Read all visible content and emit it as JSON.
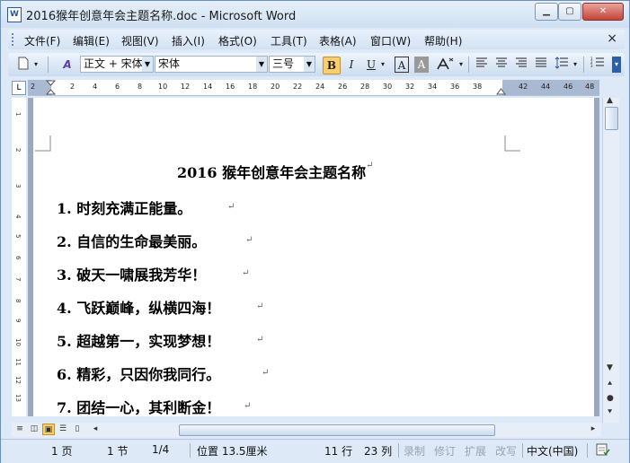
{
  "window": {
    "title": "2016猴年创意年会主题名称.doc - Microsoft Word",
    "app_icon": "W",
    "minimize": "▁",
    "maximize": "▢",
    "close": "✕"
  },
  "menu": {
    "items": [
      "文件(F)",
      "编辑(E)",
      "视图(V)",
      "插入(I)",
      "格式(O)",
      "工具(T)",
      "表格(A)",
      "窗口(W)",
      "帮助(H)"
    ],
    "close": "×"
  },
  "toolbar": {
    "style_value": "正文 + 宋体",
    "font_value": "宋体",
    "size_value": "三号",
    "bold": "B",
    "italic": "I",
    "underline": "U",
    "char_border": "A",
    "char_shading": "A"
  },
  "ruler": {
    "ticks": [
      "2",
      "2",
      "4",
      "6",
      "8",
      "10",
      "12",
      "14",
      "16",
      "18",
      "20",
      "22",
      "24",
      "26",
      "28",
      "30",
      "32",
      "34",
      "36",
      "38",
      "42",
      "44",
      "46",
      "48"
    ],
    "vticks": [
      "1",
      "2",
      "3",
      "4",
      "5",
      "6",
      "7",
      "8",
      "9",
      "10",
      "11",
      "12",
      "13",
      "14",
      "15",
      "16"
    ]
  },
  "document": {
    "title": "2016 猴年创意年会主题名称",
    "items": [
      "1. 时刻充满正能量。",
      "2. 自信的生命最美丽。",
      "3. 破天一啸展我芳华！",
      "4. 飞跃巅峰，纵横四海！",
      "5. 超越第一，实现梦想！",
      "6. 精彩，只因你我同行。",
      "7. 团结一心，其利断金！"
    ],
    "para_mark": "↵"
  },
  "statusbar": {
    "page": "1 页",
    "section": "1 节",
    "page_of": "1/4",
    "position": "位置 13.5厘米",
    "line": "11 行",
    "column": "23 列",
    "rec": "录制",
    "trk": "修订",
    "ext": "扩展",
    "ovr": "改写",
    "language": "中文(中国)"
  },
  "colors": {
    "accent": "#f8cf6f",
    "chrome": "#dde9f6",
    "doc_background": "#9aa9bf"
  }
}
